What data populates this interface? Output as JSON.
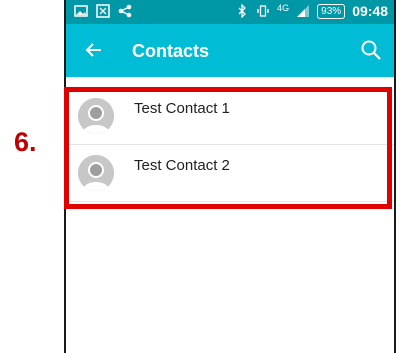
{
  "annotation": {
    "step_label": "6.",
    "highlight_color": "#e00000"
  },
  "status_bar": {
    "background": "#0097a7",
    "left_icons": [
      "image-icon",
      "gallery-icon",
      "share-icon"
    ],
    "right_icons": [
      "bluetooth-icon",
      "vibrate-icon",
      "network-4g-icon",
      "signal-icon"
    ],
    "network": "4G",
    "battery": "93%",
    "time": "09:48"
  },
  "toolbar": {
    "background": "#00bcd4",
    "back_icon": "arrow-left-icon",
    "title": "Contacts",
    "search_icon": "search-icon"
  },
  "contacts": [
    {
      "name": "Test Contact 1"
    },
    {
      "name": "Test Contact 2"
    }
  ]
}
